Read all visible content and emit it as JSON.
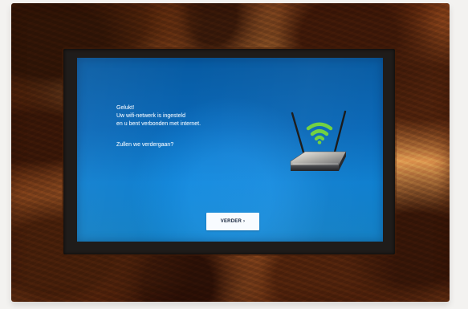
{
  "screen": {
    "message": [
      "Gelukt!",
      "Uw wifi-netwerk is ingesteld",
      "en u bent verbonden met internet.",
      "Zullen we verdergaan?"
    ],
    "continue_button": {
      "label": "VERDER",
      "icon": "chevron-right-icon",
      "icon_glyph": "›"
    },
    "illustration": {
      "icon": "router-wifi-icon",
      "wifi_color": "#6fd13d"
    }
  },
  "colors": {
    "screen_blue": "#0a68b7",
    "frame_wood": "#9b4f1c",
    "button_background": "#f8fbff",
    "text": "#eaf5ff"
  }
}
